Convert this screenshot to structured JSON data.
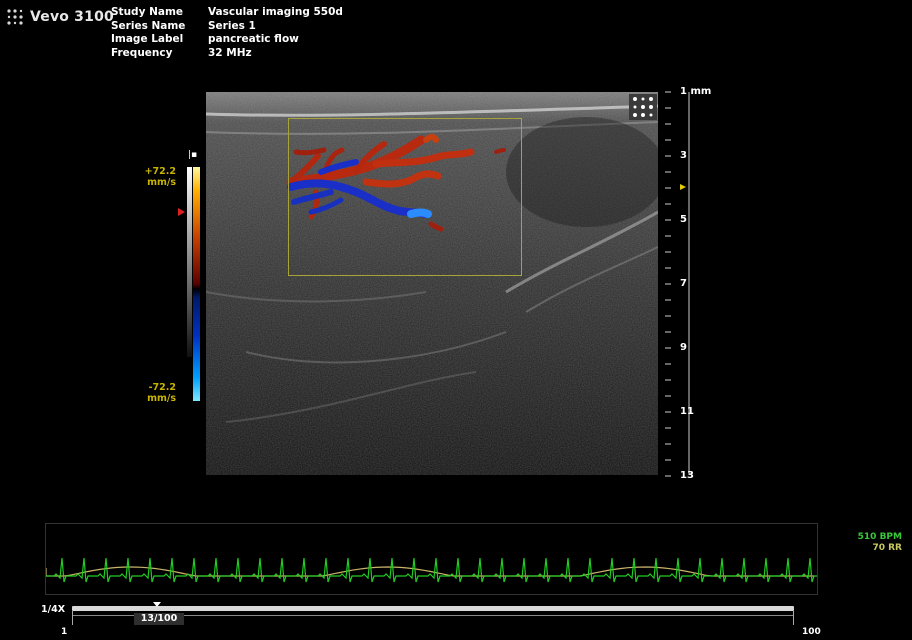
{
  "app": {
    "logo_text": "Vevo 3100",
    "logo_icon": "vevo-dots-logo"
  },
  "info": {
    "rows": [
      {
        "key": "Study Name",
        "value": "Vascular imaging 550d"
      },
      {
        "key": "Series Name",
        "value": "Series 1"
      },
      {
        "key": "Image Label",
        "value": "pancreatic flow"
      },
      {
        "key": "Frequency",
        "value": "32 MHz"
      }
    ]
  },
  "color_scale": {
    "top_value": "+72.2",
    "top_unit": "mm/s",
    "bottom_value": "-72.2",
    "bottom_unit": "mm/s",
    "positive_color": "#c83000",
    "negative_color": "#0030c0"
  },
  "depth_scale": {
    "labels": [
      "1 mm",
      "3",
      "5",
      "7",
      "9",
      "11",
      "13"
    ],
    "marker_color": "#e0d000"
  },
  "physio": {
    "bpm": "510 BPM",
    "rr": "70 RR",
    "ecg_color": "#22cc22",
    "resp_color": "#c8b46a"
  },
  "timeline": {
    "speed": "1/4X",
    "frame": "13/100",
    "start": "1",
    "end": "100",
    "position_fraction": 0.12
  }
}
